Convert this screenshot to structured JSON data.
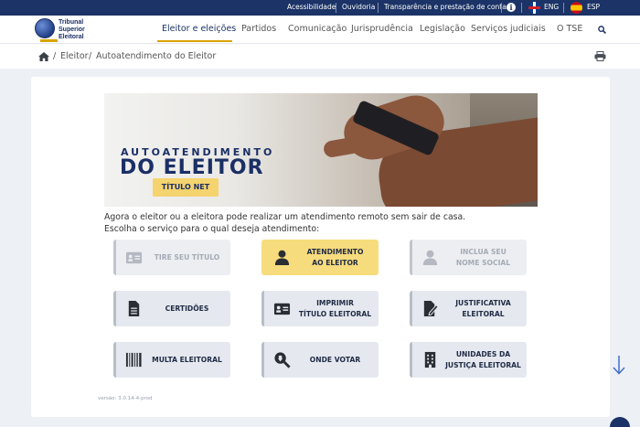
{
  "topbar": {
    "links": [
      "Acessibilidade",
      "Ouvidoria",
      "Transparência e prestação de contas"
    ],
    "lang_en": "ENG",
    "lang_es": "ESP"
  },
  "logo": {
    "line1": "Tribunal",
    "line2": "Superior",
    "line3": "Eleitoral"
  },
  "nav": {
    "items": [
      "Eleitor e eleições",
      "Partidos",
      "Comunicação",
      "Jurisprudência",
      "Legislação",
      "Serviços judiciais",
      "O TSE"
    ],
    "active_index": 0
  },
  "breadcrumb": {
    "items": [
      "Eleitor",
      "Autoatendimento do Eleitor"
    ],
    "separator": "/"
  },
  "banner": {
    "line1": "AUTOATENDIMENTO",
    "line2": "DO ELEITOR",
    "badge": "TÍTULO NET"
  },
  "intro": {
    "line1": "Agora o eleitor ou a eleitora pode realizar um atendimento remoto sem sair de casa.",
    "line2": "Escolha o serviço para o qual deseja atendimento:"
  },
  "services": [
    {
      "label": "TIRE SEU TÍTULO",
      "icon": "id-card-icon",
      "state": "disabled"
    },
    {
      "label": "ATENDIMENTO\nAO ELEITOR",
      "icon": "user-icon",
      "state": "highlight"
    },
    {
      "label": "INCLUA SEU\nNOME SOCIAL",
      "icon": "user-icon",
      "state": "disabled"
    },
    {
      "label": "CERTIDÕES",
      "icon": "document-icon",
      "state": "normal"
    },
    {
      "label": "IMPRIMIR\nTÍTULO ELEITORAL",
      "icon": "id-card-icon",
      "state": "normal"
    },
    {
      "label": "JUSTIFICATIVA\nELEITORAL",
      "icon": "edit-document-icon",
      "state": "normal"
    },
    {
      "label": "MULTA ELEITORAL",
      "icon": "barcode-icon",
      "state": "normal"
    },
    {
      "label": "ONDE VOTAR",
      "icon": "search-location-icon",
      "state": "normal"
    },
    {
      "label": "UNIDADES DA\nJUSTIÇA ELEITORAL",
      "icon": "building-icon",
      "state": "normal"
    }
  ],
  "version": "versão: 3.0.14-4-prod",
  "colors": {
    "navy": "#1b3366",
    "gold": "#d9a400",
    "highlight_tile": "#f7dc7d",
    "tile": "#e5e9ef"
  }
}
